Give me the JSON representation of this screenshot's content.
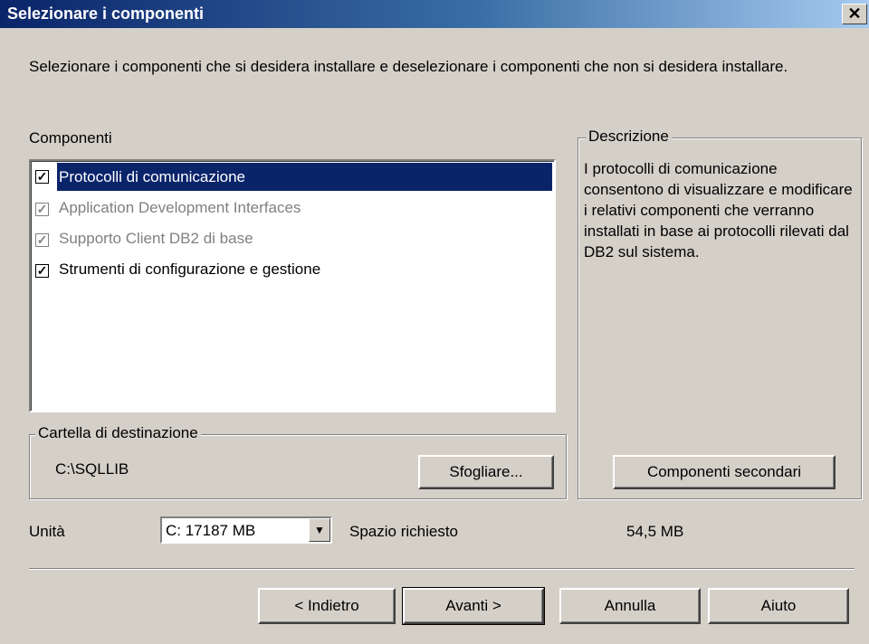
{
  "window": {
    "title": "Selezionare i componenti",
    "close_glyph": "✕"
  },
  "intro": "Selezionare i componenti che si desidera installare e deselezionare i componenti che non si desidera installare.",
  "components": {
    "label": "Componenti",
    "items": [
      {
        "label": "Protocolli di comunicazione",
        "checked": true,
        "selected": true,
        "disabled": false
      },
      {
        "label": "Application Development Interfaces",
        "checked": true,
        "selected": false,
        "disabled": true
      },
      {
        "label": "Supporto Client DB2 di base",
        "checked": true,
        "selected": false,
        "disabled": true
      },
      {
        "label": "Strumenti di configurazione e gestione",
        "checked": true,
        "selected": false,
        "disabled": false
      }
    ]
  },
  "description": {
    "title": "Descrizione",
    "text": "I protocolli di comunicazione consentono di visualizzare e modificare i relativi componenti che verranno installati in base ai protocolli rilevati dal DB2 sul sistema.",
    "subcomponents_button": "Componenti secondari"
  },
  "destination": {
    "title": "Cartella di destinazione",
    "path": "C:\\SQLLIB",
    "browse_button": "Sfogliare..."
  },
  "drive": {
    "label": "Unità",
    "selected": "C: 17187 MB",
    "space_label": "Spazio richiesto",
    "space_value": "54,5 MB"
  },
  "buttons": {
    "back": "< Indietro",
    "next": "Avanti >",
    "cancel": "Annulla",
    "help": "Aiuto"
  }
}
